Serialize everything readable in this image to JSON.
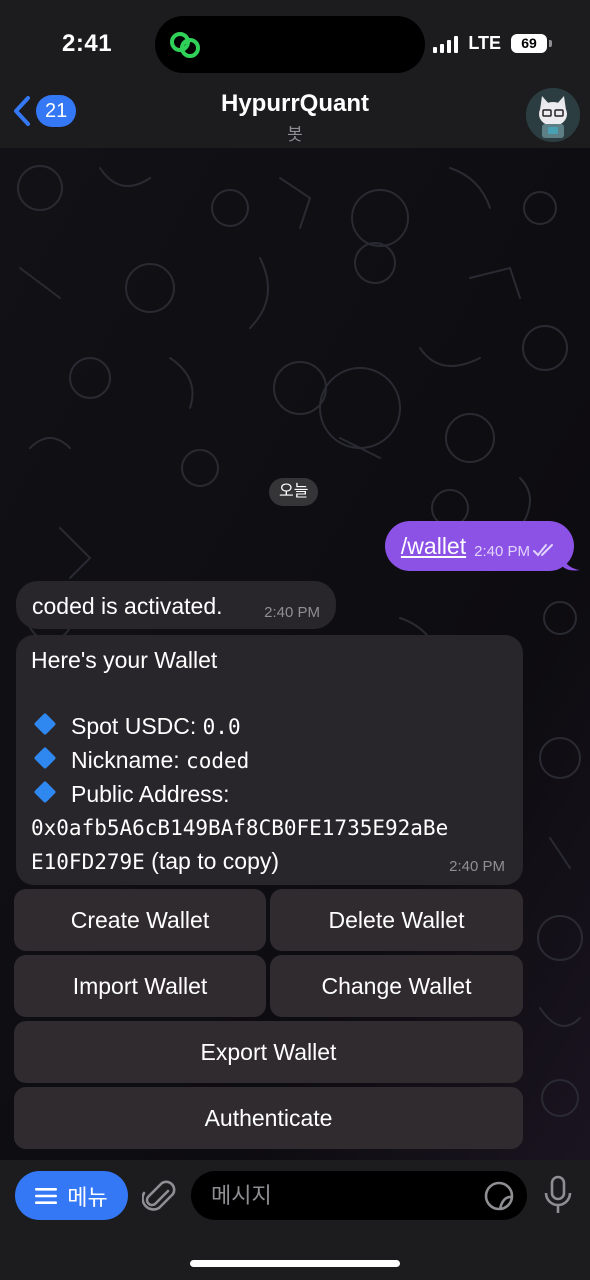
{
  "status": {
    "time": "2:41",
    "network": "LTE",
    "battery": "69"
  },
  "header": {
    "back_count": "21",
    "title": "HypurrQuant",
    "subtitle": "봇"
  },
  "chat": {
    "date": "오늘",
    "outgoing": {
      "text": "/wallet",
      "time": "2:40 PM"
    },
    "activated": {
      "text": "coded is activated.",
      "time": "2:40 PM"
    },
    "wallet": {
      "heading": "Here's your Wallet",
      "spot_label": "Spot USDC: ",
      "spot_value": "0.0",
      "nickname_label": "Nickname: ",
      "nickname_value": "coded",
      "address_label": "Public Address:",
      "address_line1": "0x0afb5A6cB149BAf8CB0FE1735E92aBe",
      "address_line2": "E10FD279E",
      "address_hint": " (tap to copy)",
      "time": "2:40 PM"
    },
    "buttons": {
      "create": "Create Wallet",
      "delete": "Delete Wallet",
      "import": "Import Wallet",
      "change": "Change Wallet",
      "export": "Export Wallet",
      "authenticate": "Authenticate"
    }
  },
  "input": {
    "menu_label": "메뉴",
    "placeholder": "메시지"
  },
  "colors": {
    "accent": "#3478f6",
    "outgoing_bubble": "#8c52e6",
    "incoming_bubble": "#28262b",
    "keyboard_button": "#2f2b2e",
    "diamond": "#2f87f0"
  }
}
